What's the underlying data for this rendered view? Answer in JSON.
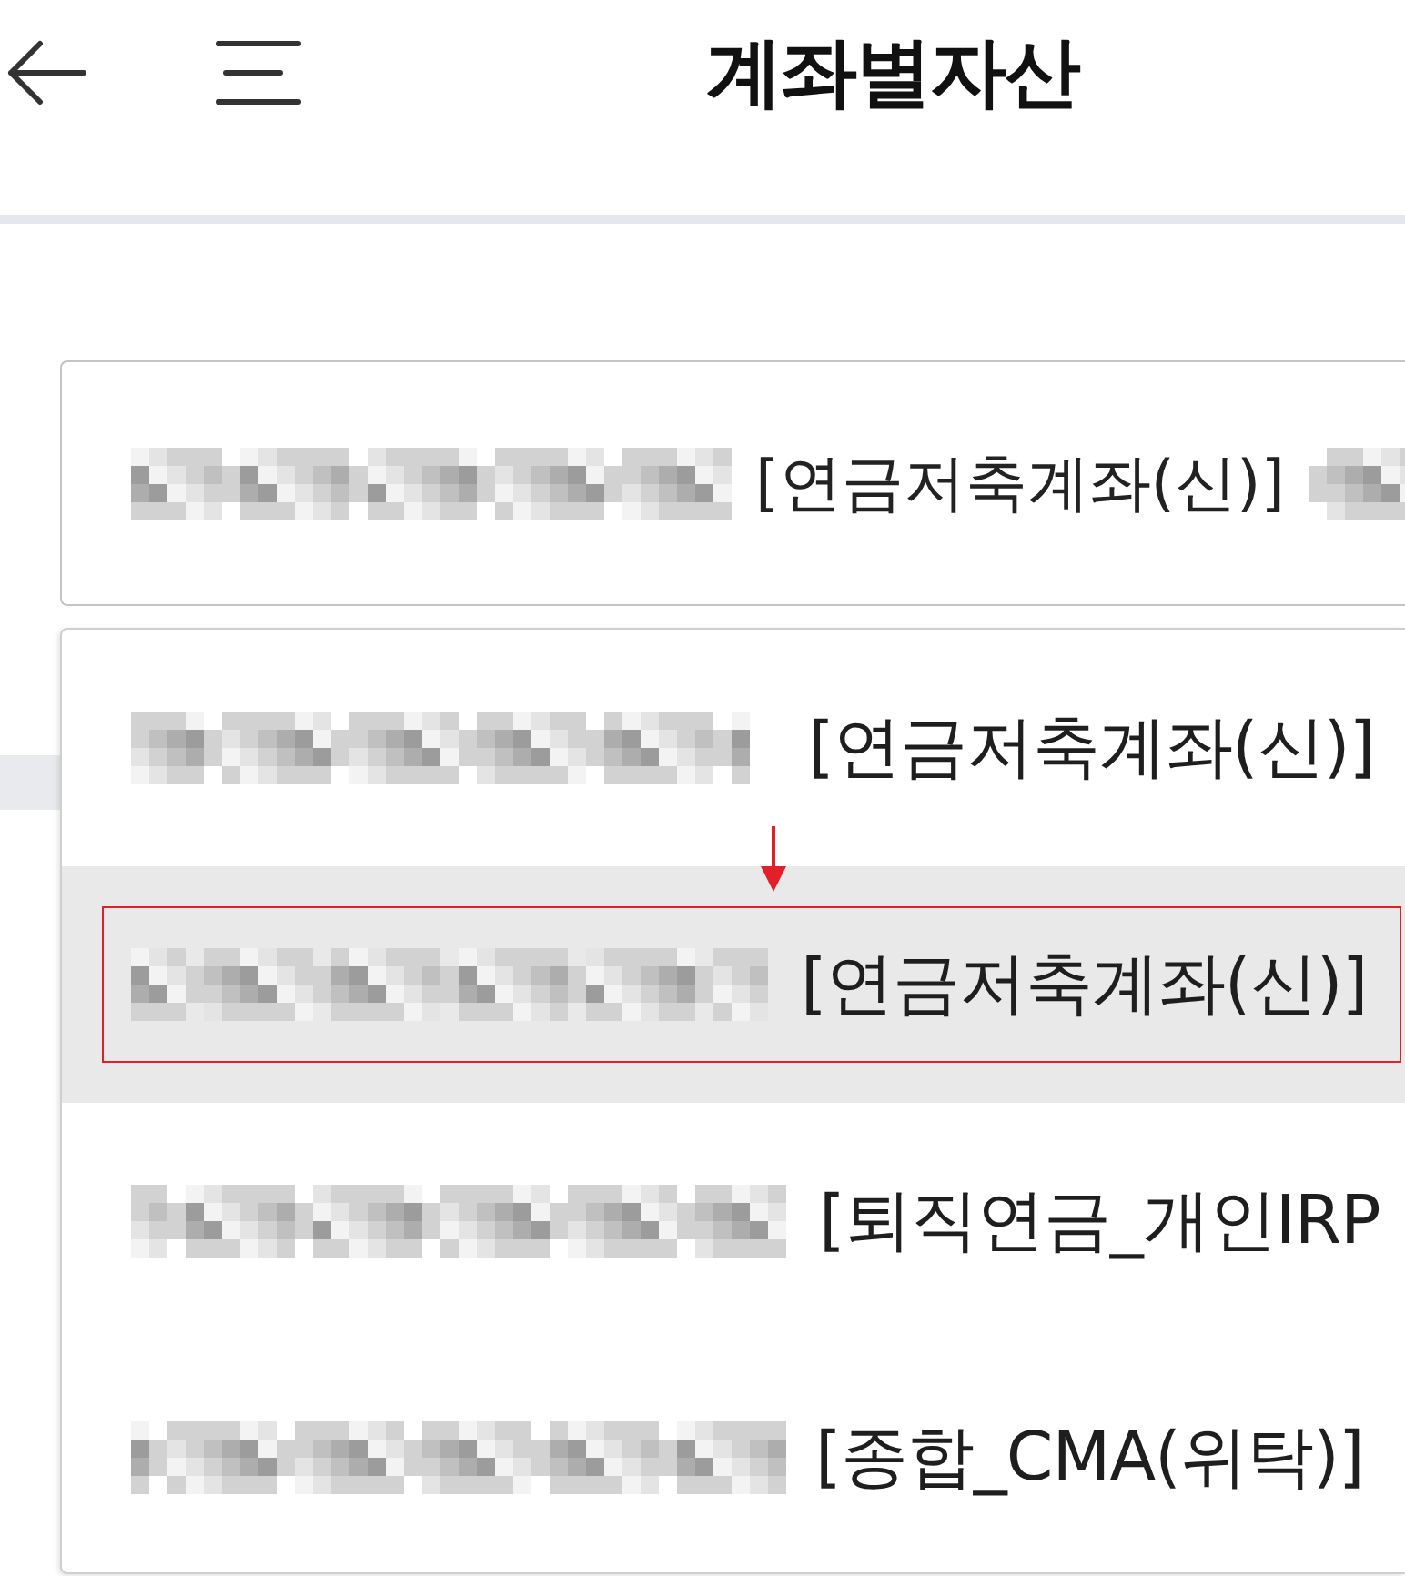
{
  "header": {
    "title": "계좌별자산"
  },
  "account_select": {
    "label": "[연금저축계좌(신)]"
  },
  "account_options": [
    {
      "label": "[연금저축계좌(신)]",
      "selected": false,
      "annotated": false
    },
    {
      "label": "[연금저축계좌(신)]",
      "selected": true,
      "annotated": true
    },
    {
      "label": "[퇴직연금_개인IRP",
      "selected": false,
      "annotated": false
    },
    {
      "label": "[종합_CMA(위탁)]",
      "selected": false,
      "annotated": false
    }
  ]
}
